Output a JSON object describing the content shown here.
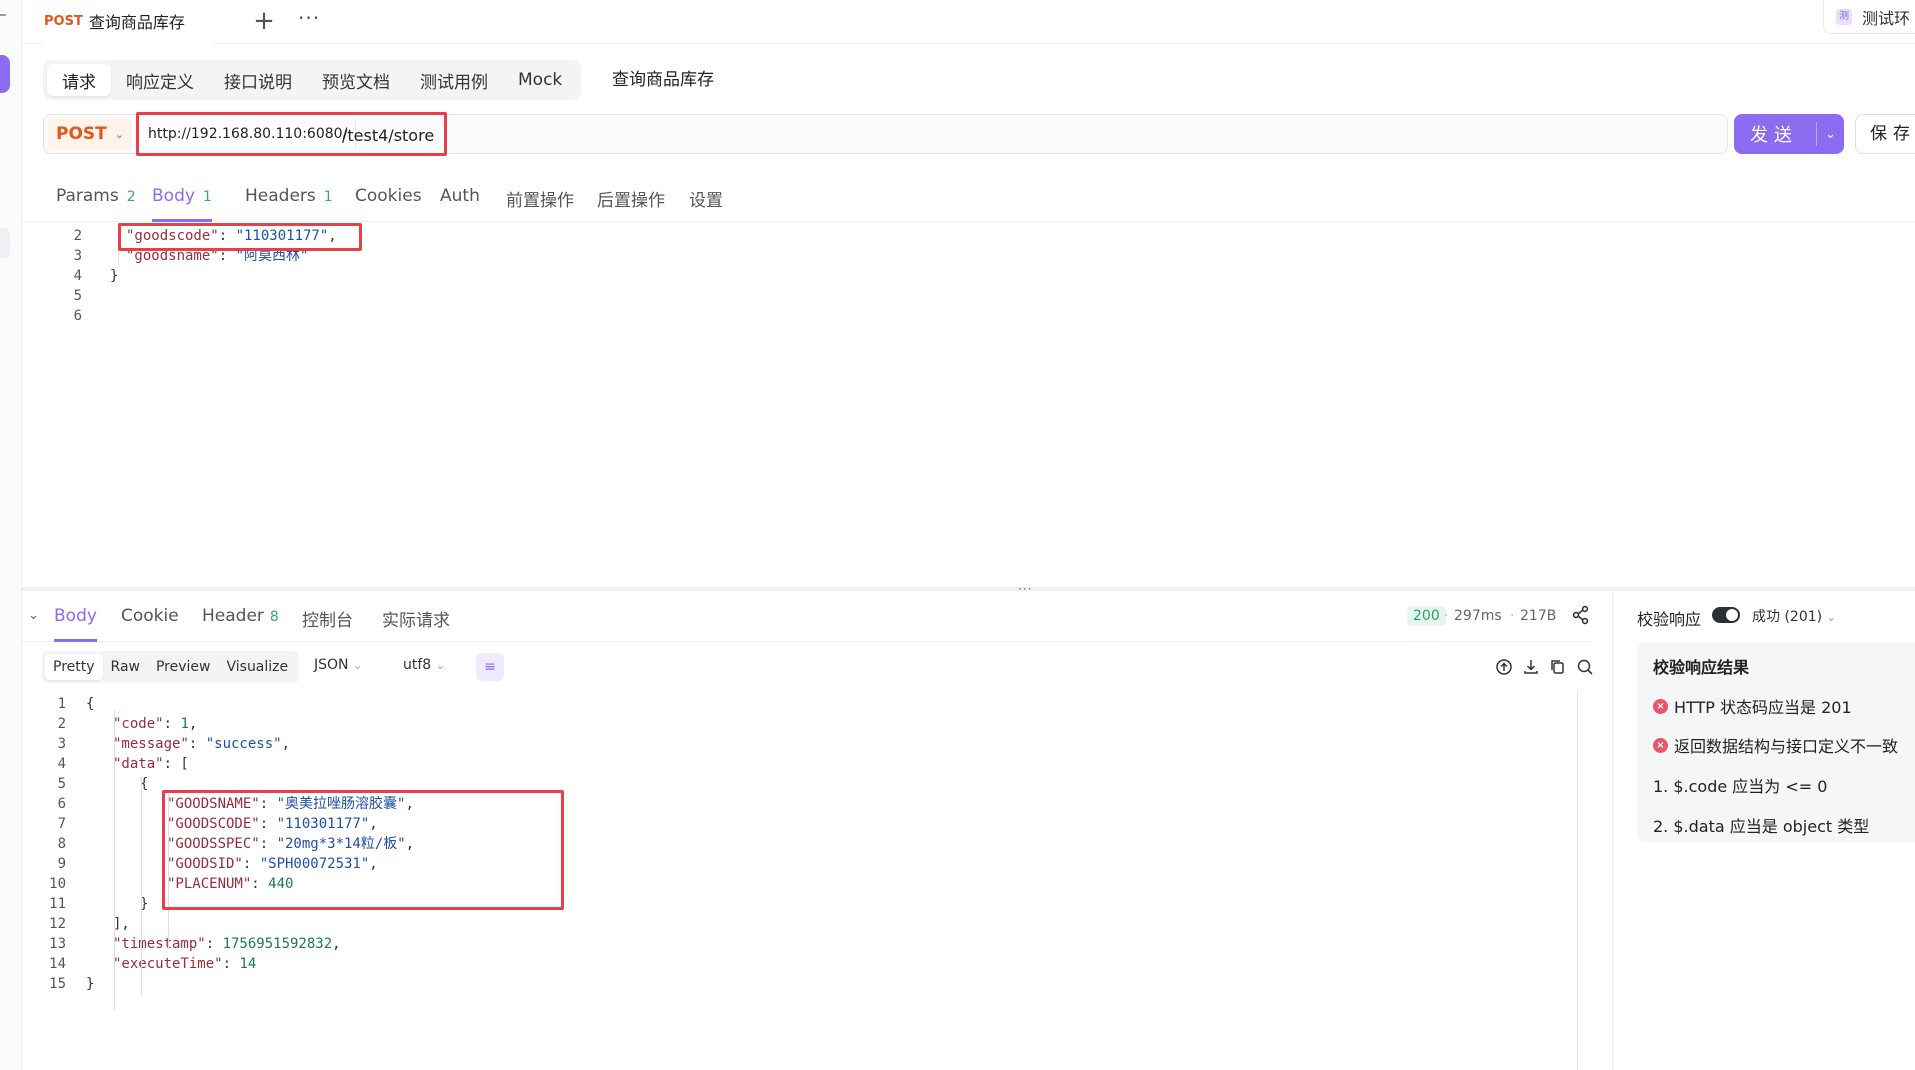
{
  "tab": {
    "method": "POST",
    "title": "查询商品库存",
    "plus": "+",
    "more": "···"
  },
  "env": {
    "icon_text": "测",
    "label": "测试环"
  },
  "section_tabs": [
    "请求",
    "响应定义",
    "接口说明",
    "预览文档",
    "测试用例",
    "Mock"
  ],
  "section_name": "查询商品库存",
  "url": {
    "method": "POST",
    "base": "http://192.168.80.110:6080/",
    "path": "/test4/store"
  },
  "send_label": "发送",
  "save_label": "保存",
  "request_tabs": [
    {
      "label": "Params",
      "count": "2"
    },
    {
      "label": "Body",
      "count": "1"
    },
    {
      "label": "Headers",
      "count": "1"
    },
    {
      "label": "Cookies",
      "count": ""
    },
    {
      "label": "Auth",
      "count": ""
    },
    {
      "label": "前置操作",
      "count": ""
    },
    {
      "label": "后置操作",
      "count": ""
    },
    {
      "label": "设置",
      "count": ""
    }
  ],
  "request_body": {
    "line_numbers": [
      "2",
      "3",
      "4",
      "5",
      "6"
    ],
    "line2_key": "\"goodscode\"",
    "line2_val": "\"110301177\"",
    "line3_key": "\"goodsname\"",
    "line3_val": "\"阿莫西林\"",
    "line4": "}"
  },
  "response_tabs": [
    {
      "label": "Body",
      "count": ""
    },
    {
      "label": "Cookie",
      "count": ""
    },
    {
      "label": "Header",
      "count": "8"
    },
    {
      "label": "控制台",
      "count": ""
    },
    {
      "label": "实际请求",
      "count": ""
    }
  ],
  "response_meta": {
    "status": "200",
    "time": "297ms",
    "size": "217B"
  },
  "view_tabs": [
    "Pretty",
    "Raw",
    "Preview",
    "Visualize"
  ],
  "format": "JSON",
  "encoding": "utf8",
  "response_lines": [
    {
      "n": "1",
      "indent": 0,
      "parts": [
        [
          "p",
          "{"
        ]
      ]
    },
    {
      "n": "2",
      "indent": 1,
      "parts": [
        [
          "k",
          "\"code\""
        ],
        [
          "p",
          ": "
        ],
        [
          "n",
          "1"
        ],
        [
          "p",
          ","
        ]
      ]
    },
    {
      "n": "3",
      "indent": 1,
      "parts": [
        [
          "k",
          "\"message\""
        ],
        [
          "p",
          ": "
        ],
        [
          "s",
          "\"success\""
        ],
        [
          "p",
          ","
        ]
      ]
    },
    {
      "n": "4",
      "indent": 1,
      "parts": [
        [
          "k",
          "\"data\""
        ],
        [
          "p",
          ": ["
        ]
      ]
    },
    {
      "n": "5",
      "indent": 2,
      "parts": [
        [
          "p",
          "{"
        ]
      ]
    },
    {
      "n": "6",
      "indent": 3,
      "parts": [
        [
          "k",
          "\"GOODSNAME\""
        ],
        [
          "p",
          ": "
        ],
        [
          "s",
          "\"奥美拉唑肠溶胶囊\""
        ],
        [
          "p",
          ","
        ]
      ]
    },
    {
      "n": "7",
      "indent": 3,
      "parts": [
        [
          "k",
          "\"GOODSCODE\""
        ],
        [
          "p",
          ": "
        ],
        [
          "s",
          "\"110301177\""
        ],
        [
          "p",
          ","
        ]
      ]
    },
    {
      "n": "8",
      "indent": 3,
      "parts": [
        [
          "k",
          "\"GOODSSPEC\""
        ],
        [
          "p",
          ": "
        ],
        [
          "s",
          "\"20mg*3*14粒/板\""
        ],
        [
          "p",
          ","
        ]
      ]
    },
    {
      "n": "9",
      "indent": 3,
      "parts": [
        [
          "k",
          "\"GOODSID\""
        ],
        [
          "p",
          ": "
        ],
        [
          "s",
          "\"SPH00072531\""
        ],
        [
          "p",
          ","
        ]
      ]
    },
    {
      "n": "10",
      "indent": 3,
      "parts": [
        [
          "k",
          "\"PLACENUM\""
        ],
        [
          "p",
          ": "
        ],
        [
          "n",
          "440"
        ]
      ]
    },
    {
      "n": "11",
      "indent": 2,
      "parts": [
        [
          "p",
          "}"
        ]
      ]
    },
    {
      "n": "12",
      "indent": 1,
      "parts": [
        [
          "p",
          "],"
        ]
      ]
    },
    {
      "n": "13",
      "indent": 1,
      "parts": [
        [
          "k",
          "\"timestamp\""
        ],
        [
          "p",
          ": "
        ],
        [
          "n",
          "1756951592832"
        ],
        [
          "p",
          ","
        ]
      ]
    },
    {
      "n": "14",
      "indent": 1,
      "parts": [
        [
          "k",
          "\"executeTime\""
        ],
        [
          "p",
          ": "
        ],
        [
          "n",
          "14"
        ]
      ]
    },
    {
      "n": "15",
      "indent": 0,
      "parts": [
        [
          "p",
          "}"
        ]
      ]
    }
  ],
  "validation": {
    "title": "校验响应",
    "status": "成功 (201)",
    "panel_title": "校验响应结果",
    "errors": [
      "HTTP 状态码应当是 201",
      "返回数据结构与接口定义不一致"
    ],
    "items": [
      "1. $.code 应当为 <= 0",
      "2. $.data 应当是 object 类型"
    ]
  },
  "colors": {
    "accent": "#8b6cf0",
    "method": "#e0561c",
    "highlight": "#e83f4b",
    "success": "#2f9e67"
  }
}
